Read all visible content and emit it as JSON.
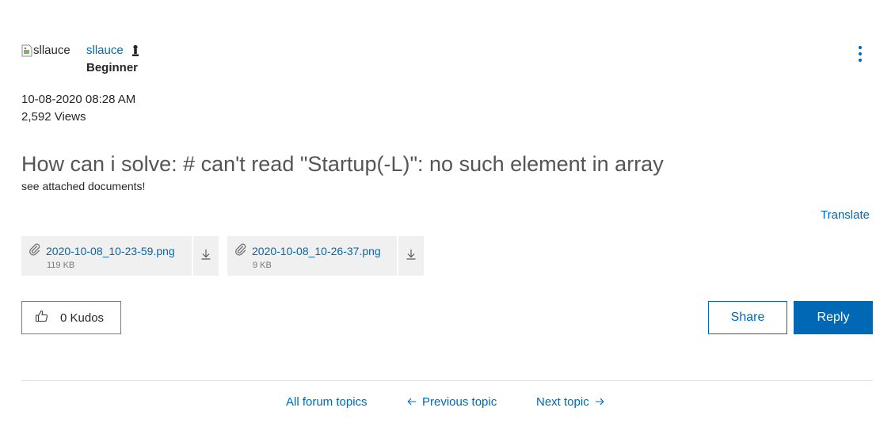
{
  "author": {
    "avatar_alt": "sllauce",
    "name": "sllauce",
    "rank": "Beginner"
  },
  "meta": {
    "date": "10-08-2020 08:28 AM",
    "views": "2,592 Views"
  },
  "post": {
    "title": "How can i solve: # can't read \"Startup(-L)\": no such element in array",
    "body": "see attached documents!",
    "translate_label": "Translate"
  },
  "attachments": [
    {
      "name": "2020-10-08_10-23-59.png",
      "size": "119 KB"
    },
    {
      "name": "2020-10-08_10-26-37.png",
      "size": "9 KB"
    }
  ],
  "actions": {
    "kudos_label": "0 Kudos",
    "share_label": "Share",
    "reply_label": "Reply"
  },
  "footer": {
    "all_topics": "All forum topics",
    "previous": "Previous topic",
    "next": "Next topic"
  },
  "colors": {
    "link": "#0068b5",
    "text": "#262626",
    "title": "#555555",
    "attachment_bg": "#f0f0f0"
  }
}
